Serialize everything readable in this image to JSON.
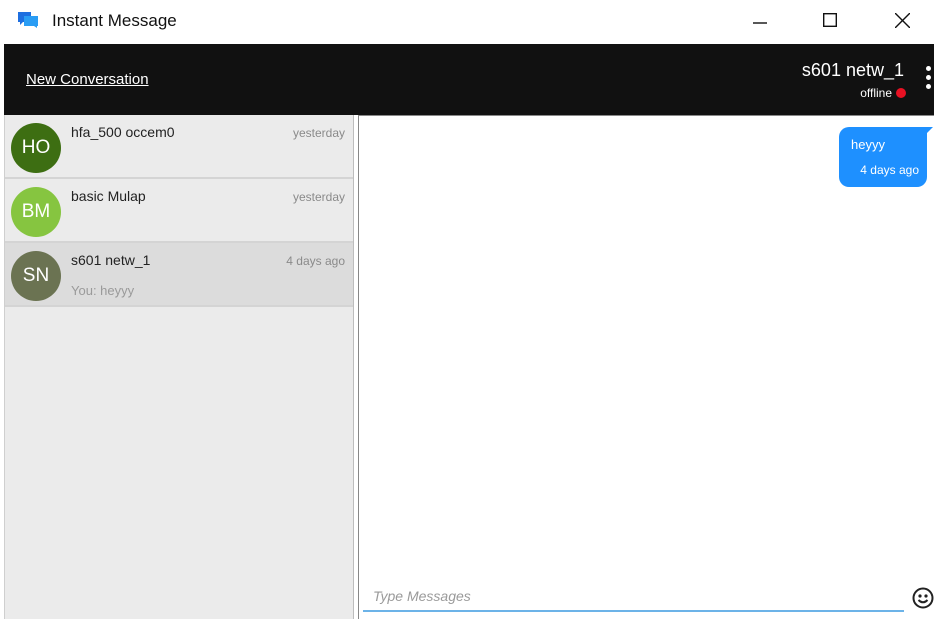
{
  "window": {
    "title": "Instant Message",
    "accent": "#1e90ff"
  },
  "header": {
    "new_conversation_label": "New Conversation",
    "contact_name": "s601 netw_1",
    "contact_status": "offline",
    "status_color": "#e81123"
  },
  "conversations": [
    {
      "initials": "HO",
      "name": "hfa_500 occem0",
      "time": "yesterday",
      "preview": "",
      "avatar_color": "#3d6e12"
    },
    {
      "initials": "BM",
      "name": "basic Mulap",
      "time": "yesterday",
      "preview": "",
      "avatar_color": "#86c540"
    },
    {
      "initials": "SN",
      "name": "s601 netw_1",
      "time": "4 days ago",
      "preview": "You: heyyy",
      "avatar_color": "#6b7352"
    }
  ],
  "messages": [
    {
      "text": "heyyy",
      "time": "4 days ago",
      "sent": true
    }
  ],
  "composer": {
    "placeholder": "Type Messages"
  }
}
